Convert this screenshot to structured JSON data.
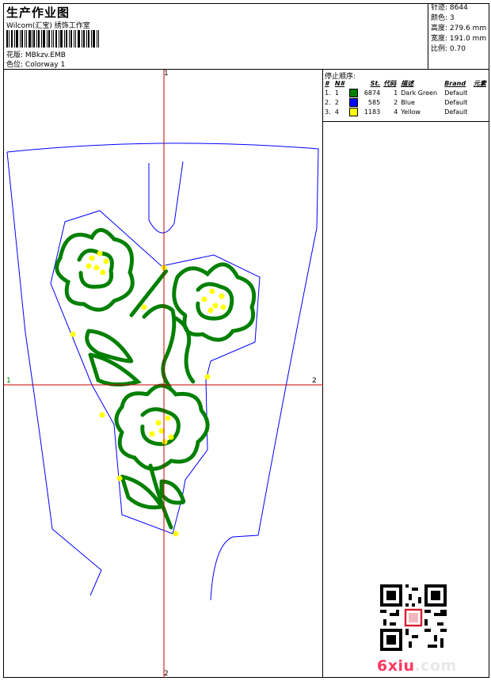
{
  "header": {
    "title": "生产作业图",
    "subtitle": "Wilcom(汇宝) 绣饰工作室",
    "design_label": "花版:",
    "design_value": "MBkzv.EMB",
    "colorway_label": "色位:",
    "colorway_value": "Colorway 1"
  },
  "stats": [
    {
      "label": "针迹:",
      "value": "8644"
    },
    {
      "label": "颜色:",
      "value": "3"
    },
    {
      "label": "高度:",
      "value": "279.6 mm"
    },
    {
      "label": "宽度:",
      "value": "191.0 mm"
    },
    {
      "label": "比例:",
      "value": "0.70"
    }
  ],
  "stop_sequence": {
    "title": "停止顺序:",
    "headers": {
      "idx": "#",
      "no": "N#",
      "st": "St.",
      "code": "代码",
      "desc": "描述",
      "brand": "Brand",
      "element": "元素"
    },
    "rows": [
      {
        "idx": "1.",
        "no": "1",
        "color": "#008000",
        "st": "6874",
        "code": "1",
        "desc": "Dark Green",
        "brand": "Default"
      },
      {
        "idx": "2.",
        "no": "2",
        "color": "#0000ff",
        "st": "585",
        "code": "2",
        "desc": "Blue",
        "brand": "Default"
      },
      {
        "idx": "3.",
        "no": "4",
        "color": "#ffff00",
        "st": "1183",
        "code": "4",
        "desc": "Yellow",
        "brand": "Default"
      }
    ]
  },
  "axes": {
    "top": "1",
    "left": "1",
    "right": "2",
    "bottom": "2"
  },
  "watermark": {
    "brand_a": "6xiu",
    "brand_b": ".com"
  },
  "colors": {
    "green": "#008000",
    "blue": "#0000ff",
    "yellow": "#ffff00",
    "red_axis": "#cc0000"
  }
}
